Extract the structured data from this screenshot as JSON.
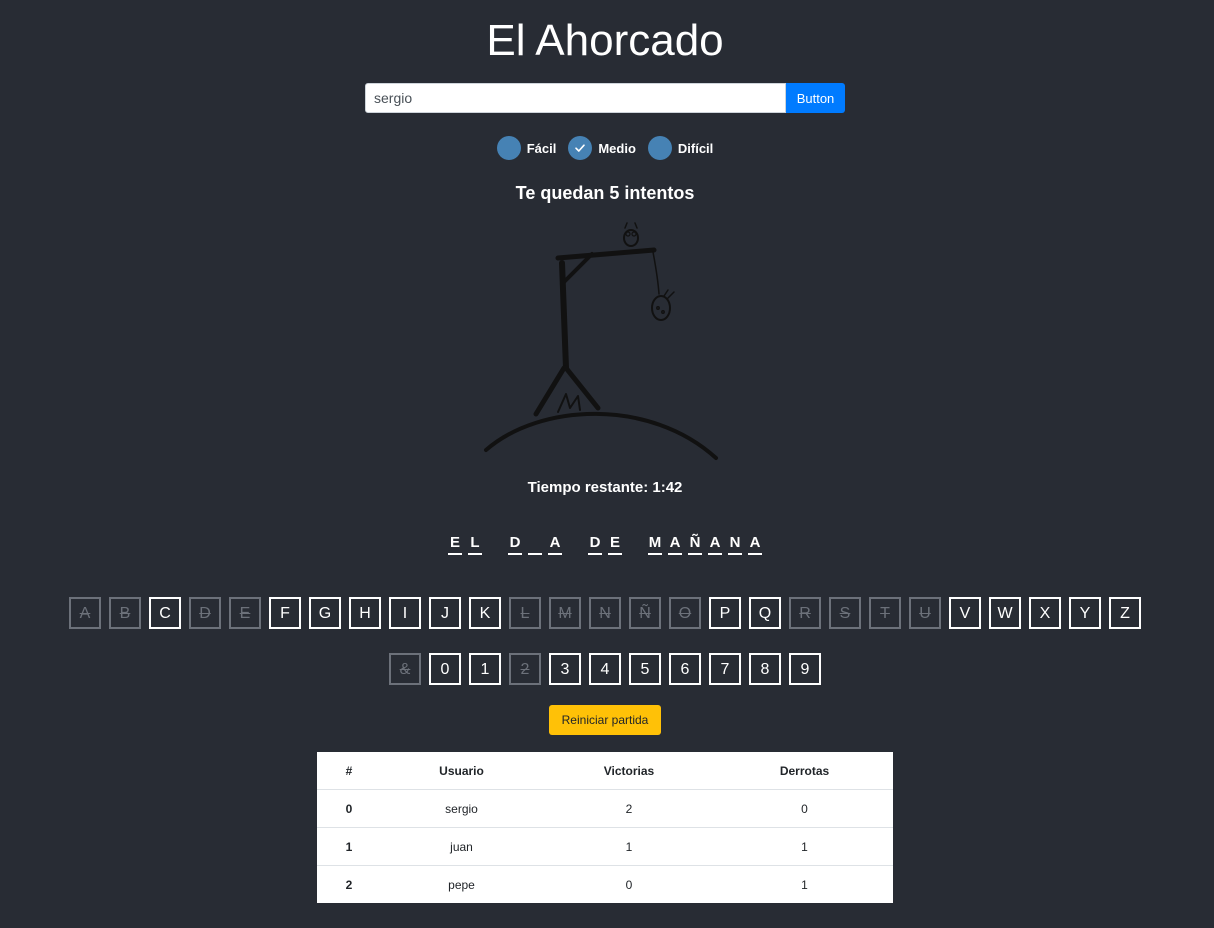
{
  "title": "El Ahorcado",
  "search": {
    "value": "sergio",
    "button_label": "Button"
  },
  "difficulty": {
    "options": [
      {
        "label": "Fácil",
        "checked": false
      },
      {
        "label": "Medio",
        "checked": true
      },
      {
        "label": "Difícil",
        "checked": false
      }
    ]
  },
  "status": {
    "attempts": "Te quedan 5 intentos",
    "timer": "Tiempo restante: 1:42"
  },
  "word": {
    "letters": [
      "E",
      "L",
      " ",
      "D",
      "",
      "A",
      " ",
      "D",
      "E",
      " ",
      "M",
      "A",
      "Ñ",
      "A",
      "N",
      "A"
    ]
  },
  "keyboard": {
    "row1": [
      {
        "key": "A",
        "used": true
      },
      {
        "key": "B",
        "used": true
      },
      {
        "key": "C",
        "used": false
      },
      {
        "key": "D",
        "used": true
      },
      {
        "key": "E",
        "used": true
      },
      {
        "key": "F",
        "used": false
      },
      {
        "key": "G",
        "used": false
      },
      {
        "key": "H",
        "used": false
      },
      {
        "key": "I",
        "used": false
      },
      {
        "key": "J",
        "used": false
      },
      {
        "key": "K",
        "used": false
      },
      {
        "key": "L",
        "used": true
      },
      {
        "key": "M",
        "used": true
      },
      {
        "key": "N",
        "used": true
      },
      {
        "key": "Ñ",
        "used": true
      },
      {
        "key": "O",
        "used": true
      },
      {
        "key": "P",
        "used": false
      },
      {
        "key": "Q",
        "used": false
      },
      {
        "key": "R",
        "used": true
      },
      {
        "key": "S",
        "used": true
      },
      {
        "key": "T",
        "used": true
      },
      {
        "key": "U",
        "used": true
      },
      {
        "key": "V",
        "used": false
      },
      {
        "key": "W",
        "used": false
      },
      {
        "key": "X",
        "used": false
      },
      {
        "key": "Y",
        "used": false
      },
      {
        "key": "Z",
        "used": false
      }
    ],
    "row2": [
      {
        "key": "&",
        "used": true
      },
      {
        "key": "0",
        "used": false
      },
      {
        "key": "1",
        "used": false
      },
      {
        "key": "2",
        "used": true
      },
      {
        "key": "3",
        "used": false
      },
      {
        "key": "4",
        "used": false
      },
      {
        "key": "5",
        "used": false
      },
      {
        "key": "6",
        "used": false
      },
      {
        "key": "7",
        "used": false
      },
      {
        "key": "8",
        "used": false
      },
      {
        "key": "9",
        "used": false
      }
    ]
  },
  "restart_label": "Reiniciar partida",
  "scores": {
    "headers": [
      "#",
      "Usuario",
      "Victorias",
      "Derrotas"
    ],
    "rows": [
      [
        "0",
        "sergio",
        "2",
        "0"
      ],
      [
        "1",
        "juan",
        "1",
        "1"
      ],
      [
        "2",
        "pepe",
        "0",
        "1"
      ]
    ]
  },
  "colors": {
    "background": "#282c34",
    "primary": "#007bff",
    "warning": "#ffc107",
    "radio": "#4682b4"
  }
}
